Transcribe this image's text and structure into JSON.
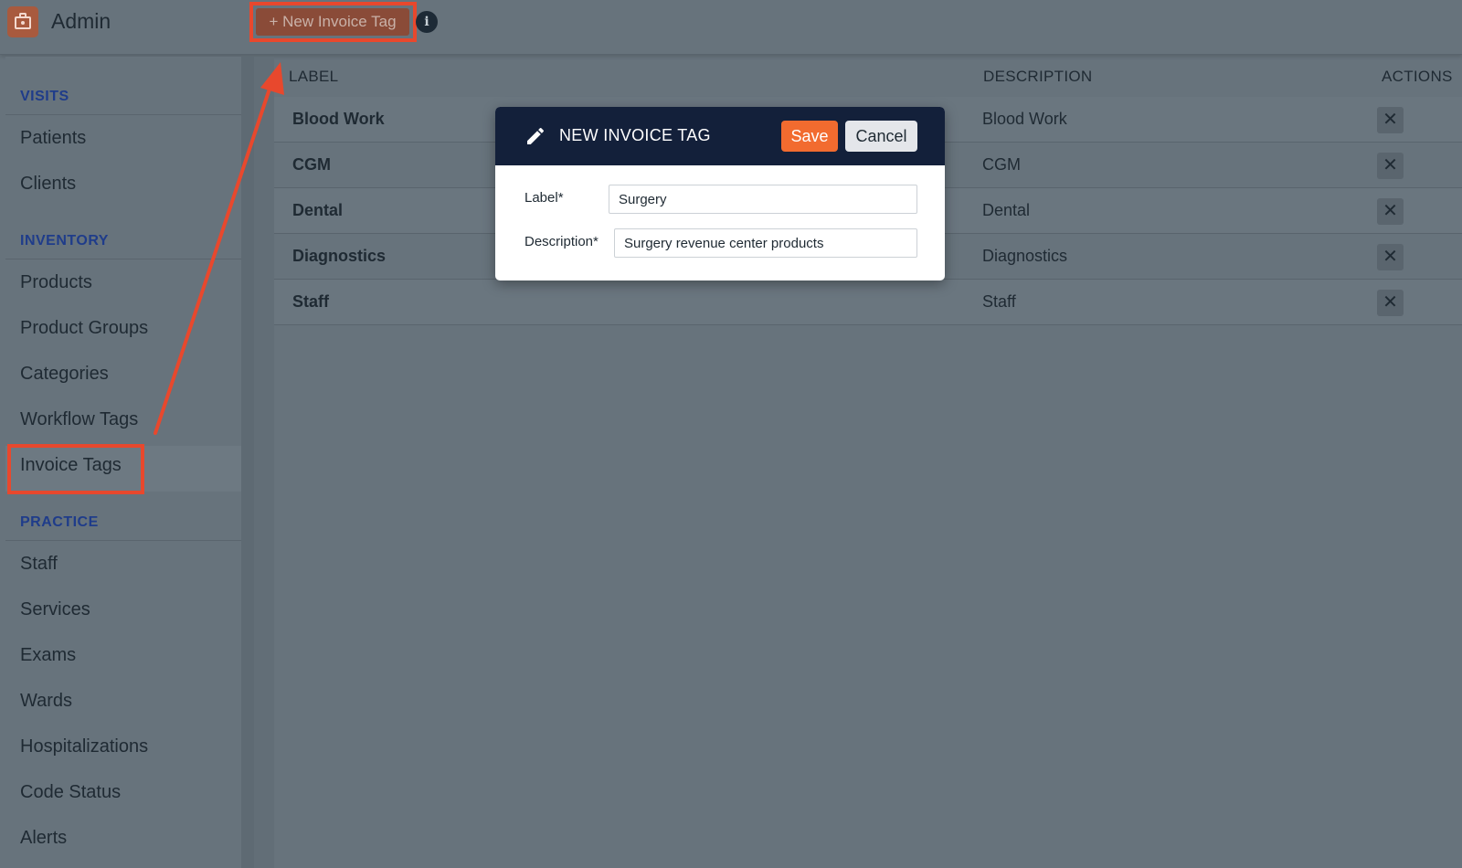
{
  "header": {
    "app_title": "Admin",
    "new_button_label": "+ New Invoice Tag",
    "info_glyph": "i"
  },
  "icons": {
    "app": "briefcase-medical-icon",
    "info": "info-icon",
    "edit": "pencil-icon",
    "delete": "close-icon"
  },
  "sidebar": {
    "sections": [
      {
        "title": "VISITS",
        "items": [
          "Patients",
          "Clients"
        ]
      },
      {
        "title": "INVENTORY",
        "items": [
          "Products",
          "Product Groups",
          "Categories",
          "Workflow Tags",
          "Invoice Tags"
        ]
      },
      {
        "title": "PRACTICE",
        "items": [
          "Staff",
          "Services",
          "Exams",
          "Wards",
          "Hospitalizations",
          "Code Status",
          "Alerts"
        ]
      }
    ],
    "active_item": "Invoice Tags"
  },
  "table": {
    "columns": [
      "LABEL",
      "DESCRIPTION",
      "ACTIONS"
    ],
    "rows": [
      {
        "label": "Blood Work",
        "description": "Blood Work"
      },
      {
        "label": "CGM",
        "description": "CGM"
      },
      {
        "label": "Dental",
        "description": "Dental"
      },
      {
        "label": "Diagnostics",
        "description": "Diagnostics"
      },
      {
        "label": "Staff",
        "description": "Staff"
      }
    ],
    "delete_glyph": "✕"
  },
  "modal": {
    "title": "NEW INVOICE TAG",
    "save_label": "Save",
    "cancel_label": "Cancel",
    "label_field": {
      "label": "Label*",
      "value": "Surgery"
    },
    "description_field": {
      "label": "Description*",
      "value": "Surgery revenue center products"
    }
  },
  "colors": {
    "accent": "#f26b2f",
    "highlight": "#e8482d",
    "modal_header": "#13203a",
    "section_heading": "#1f3c8a",
    "overlay": "#67737c"
  }
}
